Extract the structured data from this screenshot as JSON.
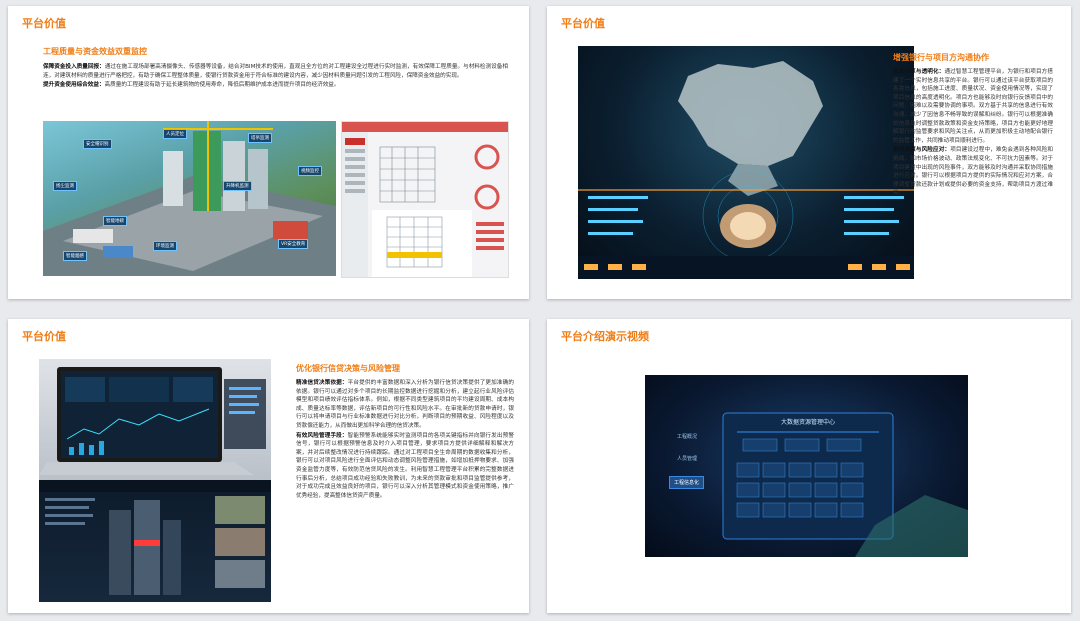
{
  "slides": [
    {
      "title": "平台价值",
      "section_title": "工程质量与资金效益双重监控",
      "paragraphs": [
        {
          "label": "保障资金投入质量回报：",
          "text": "通过在施工现场部署高清摄像头、传感器等设备，结合对BIM技术的使用，直观且全方位的对工程建设全过程进行实时监测，有效保障工程质量。与材料检测设备相连，对建筑材料的质量进行严格把控，有助于确保工程整体质量，使银行贷款资金用于符合标准的建设内容，减少因材料质量问题引发的工程风险，保障资金效益的实现。"
        },
        {
          "label": "提升资金使用综合效益：",
          "text": "高质量的工程建设有助于延长建筑物的使用寿命，降低后期维护成本进而提升项目的经济效益。"
        }
      ]
    },
    {
      "title": "",
      "section_title": "增强银行与项目方沟通协作",
      "paragraphs": [
        {
          "label": "信息共享与透明化：",
          "text": "通过智慧工程管理平台，为银行和项目方搭建了一个实时信息共享的平台。银行可以通过该平台获取项目的各类信息，包括施工进度、质量状况、资金使用情况等，实现了项目信息的高度透明化。项目方也能够及时向银行反馈项目中的问题、困难以及需要协调的事项。双方基于共享的信息进行有效沟通，减少了因信息不畅导致的误解和纠纷。银行可以根据准确的信息及时调整贷款政策和资金支持策略，项目方也能更好地理解银行的监管要求和风险关注点，从而更加积极主动地配合银行的监管工作，共同推动项目顺利进行。"
        },
        {
          "label": "协同决策与风险应对：",
          "text": "项目建设过程中，难免会遇到各种风险和挑战，如市场价格波动、政策法规变化、不可抗力因素等。对于项目建设中出现的风险事件，双方能够及时沟通并采取协同措施进行应对。银行可以根据项目方提供的实际情况和应对方案，合理调整贷款还款计划或提供必要的资金支持，帮助项目方渡过难关。"
        }
      ]
    },
    {
      "title": "平台价值",
      "section_title": "优化银行信贷决策与风险管理",
      "paragraphs": [
        {
          "label": "精准信贷决策依据：",
          "text": "平台提供的丰富数据和深入分析为银行信贷决策提供了更加准确的依据。银行可以通过对多个项目的长期监控数据进行挖掘和分析，建立起行业风险评估模型和项目绩效评估指标体系。例如，根据不同类型建筑项目的平均建设周期、成本构成、质量达标率等数据，评估新项目的可行性和风险水平。在审批新的贷款申请时，银行可以将申请项目与行业标准数据进行对比分析，判断项目的预期收益、风险程度以及贷款偿还能力，从而做出更加科学合理的信贷决策。"
        },
        {
          "label": "有效风险管理手段：",
          "text": "智能预警系统能够实时监测项目的各项关键指标并向银行发出预警信号，银行可以根据预警信息及时介入项目管理，要求项目方提供详细解释和解决方案，并对后续整改情况进行持续跟踪。通过对工程项目全生命周期的数据收集和分析，银行可以对项目风险进行全面评估和动态调整风险管理措施，如增加抵押物要求、加强资金监管力度等，有效防范信贷风险的发生。利用智慧工程管理平台积累的完整数据进行事后分析，总结项目成功经验和失败教训，为未来的贷款审批和项目监管提供参考，对于成功完成且效益良好的项目，银行可以深入分析其管理模式和资金使用策略，推广优秀经验，提高整体信贷资产质量。"
        }
      ]
    },
    {
      "title": "平台介绍演示视频",
      "video": {
        "screen_title": "大数据资源管理中心",
        "menu_items": [
          "工程概况",
          "人员管理",
          "工程信息化"
        ]
      }
    }
  ],
  "s1_image_labels": [
    "安全帽识别",
    "人员定位",
    "塔吊监测",
    "扬尘监测",
    "视频监控",
    "智能地磅",
    "升降机监测",
    "环境监测",
    "VR安全教育",
    "智能烟感"
  ],
  "colors": {
    "accent": "#f07d16",
    "text": "#333333"
  }
}
